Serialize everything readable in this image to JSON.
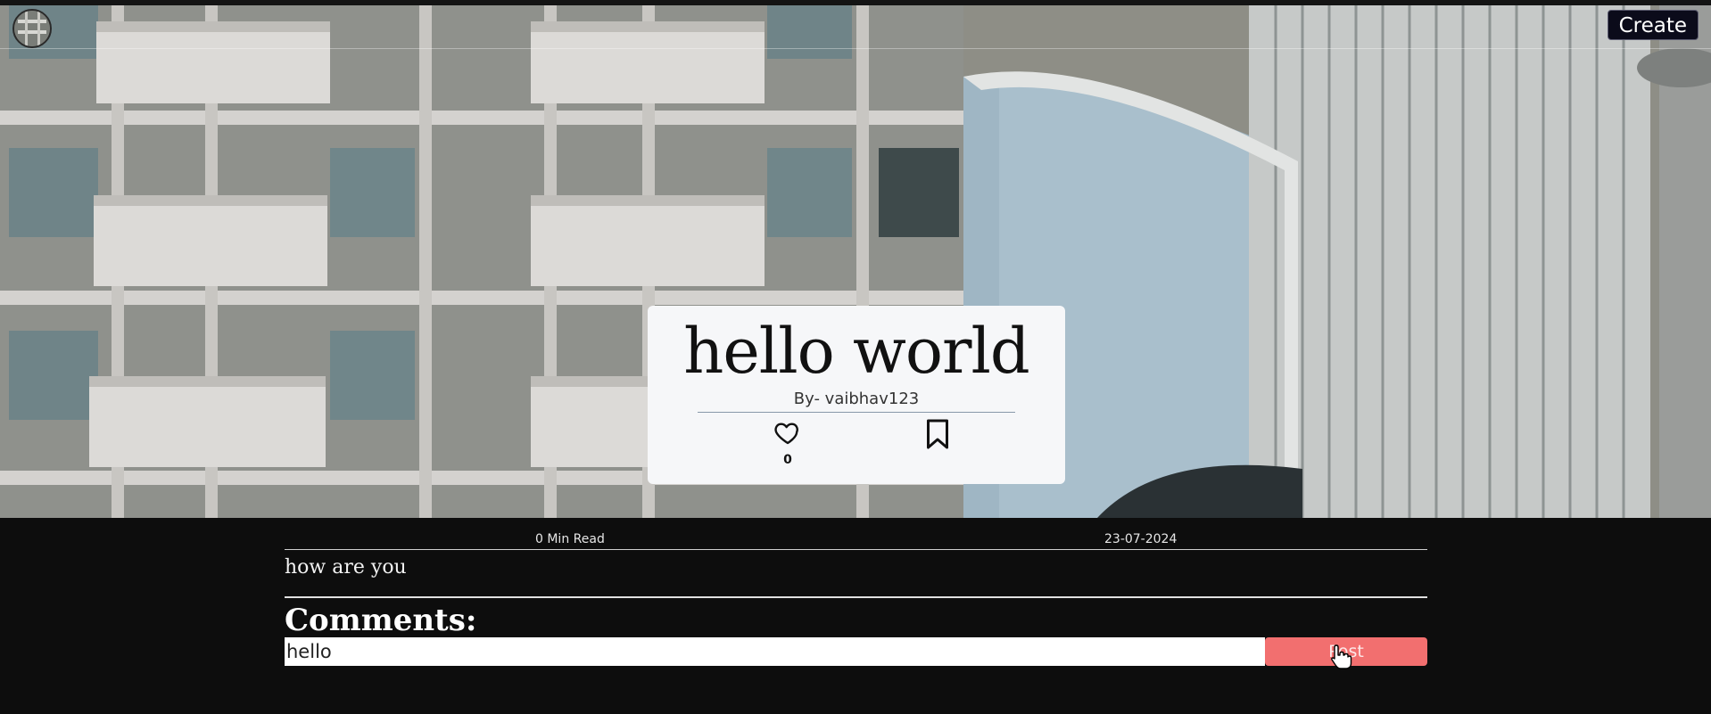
{
  "navbar": {
    "create_label": "Create",
    "avatar_icon": "avatar-photo"
  },
  "post": {
    "title": "hello world",
    "author_line": "By- vaibhav123",
    "like_count": "0",
    "like_icon": "heart-outline-icon",
    "bookmark_icon": "bookmark-outline-icon",
    "read_time": "0 Min Read",
    "date": "23-07-2024",
    "body": "how are you"
  },
  "comments": {
    "heading": "Comments:",
    "input_value": "hello",
    "post_label": "Post"
  },
  "colors": {
    "page_bg": "#0d0d0d",
    "card_bg": "#f6f7f9",
    "post_button": "#f26f6f",
    "create_button": "#0b0b1a"
  }
}
